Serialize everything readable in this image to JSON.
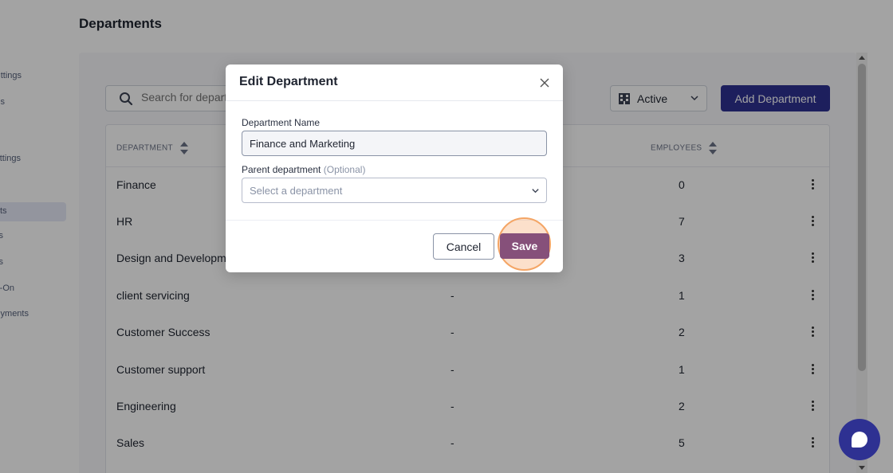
{
  "page": {
    "title": "Departments"
  },
  "sidebar": {
    "items": [
      {
        "label": "ttings"
      },
      {
        "label": "s"
      },
      {
        "label": "ttings"
      },
      {
        "label": "ts"
      },
      {
        "label": "s"
      },
      {
        "label": "s"
      },
      {
        "label": "-On"
      },
      {
        "label": "yments"
      }
    ]
  },
  "toolbar": {
    "search_placeholder": "Search for departments",
    "status_value": "Active",
    "add_label": "Add Department"
  },
  "table": {
    "headers": {
      "department": "DEPARTMENT",
      "employees": "EMPLOYEES"
    },
    "rows": [
      {
        "name": "Finance",
        "parent": "",
        "count": "0"
      },
      {
        "name": "HR",
        "parent": "",
        "count": "7"
      },
      {
        "name": "Design and Development",
        "parent": "",
        "count": "3"
      },
      {
        "name": "client servicing",
        "parent": "-",
        "count": "1"
      },
      {
        "name": "Customer Success",
        "parent": "-",
        "count": "2"
      },
      {
        "name": "Customer support",
        "parent": "-",
        "count": "1"
      },
      {
        "name": "Engineering",
        "parent": "-",
        "count": "2"
      },
      {
        "name": "Sales",
        "parent": "-",
        "count": "5"
      }
    ]
  },
  "modal": {
    "title": "Edit Department",
    "name_label": "Department Name",
    "name_value": "Finance and Marketing",
    "parent_label": "Parent department",
    "parent_optional": "(Optional)",
    "parent_placeholder": "Select a department",
    "cancel_label": "Cancel",
    "save_label": "Save"
  },
  "colors": {
    "primary": "#2e3192",
    "save": "#86507a",
    "highlight": "#f4a565"
  }
}
